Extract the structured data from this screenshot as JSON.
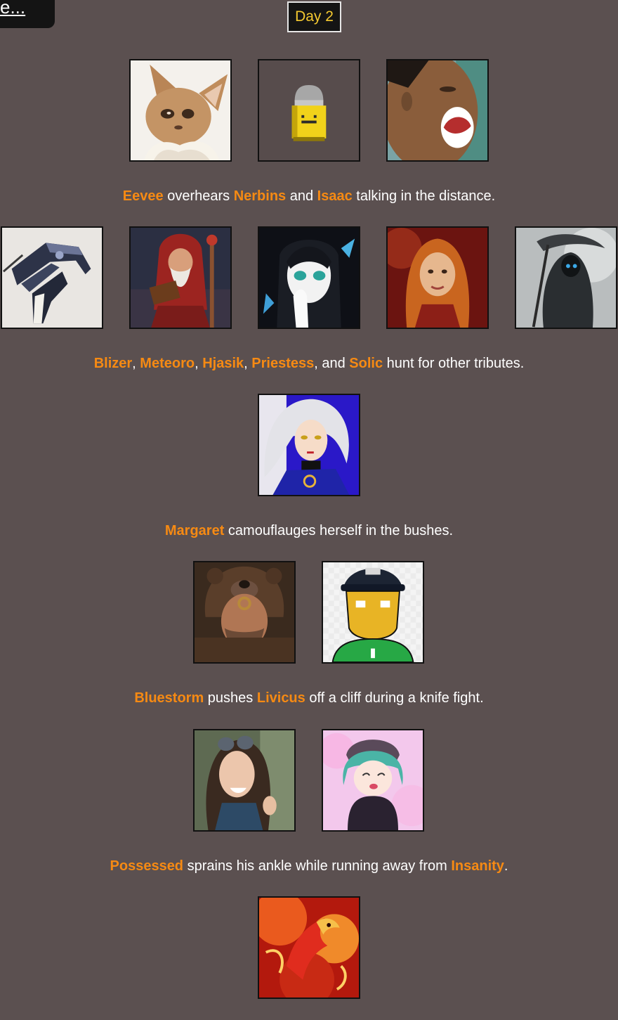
{
  "nav": {
    "back_label": "e..."
  },
  "header": {
    "day_label": "Day 2"
  },
  "colors": {
    "background": "#5b5050",
    "name_accent": "#f68a13",
    "day_text": "#f4c930"
  },
  "events": [
    {
      "portraits": [
        {
          "name": "Eevee",
          "icon": "eevee-portrait"
        },
        {
          "name": "Nerbins",
          "icon": "bullet-portrait"
        },
        {
          "name": "Isaac",
          "icon": "yelling-face-portrait"
        }
      ],
      "text": {
        "p1_name": "Eevee",
        "t1": " overhears ",
        "p2_name": "Nerbins",
        "t2": " and ",
        "p3_name": "Isaac",
        "t3": " talking in the distance."
      }
    },
    {
      "portraits": [
        {
          "name": "Blizer",
          "icon": "robot-arm-portrait"
        },
        {
          "name": "Meteoro",
          "icon": "wizard-portrait"
        },
        {
          "name": "Hjasik",
          "icon": "anime-girl-portrait"
        },
        {
          "name": "Priestess",
          "icon": "red-hair-woman-portrait"
        },
        {
          "name": "Solic",
          "icon": "reaper-portrait"
        }
      ],
      "text": {
        "p1_name": "Blizer",
        "sep1": ", ",
        "p2_name": "Meteoro",
        "sep2": ", ",
        "p3_name": "Hjasik",
        "sep3": ", ",
        "p4_name": "Priestess",
        "sep4": ", and ",
        "p5_name": "Solic",
        "tail": " hunt for other tributes."
      }
    },
    {
      "portraits": [
        {
          "name": "Margaret",
          "icon": "silver-hair-anime-portrait"
        }
      ],
      "text": {
        "p1_name": "Margaret",
        "t1": " camouflauges herself in the bushes."
      }
    },
    {
      "portraits": [
        {
          "name": "Bluestorm",
          "icon": "bear-warrior-portrait"
        },
        {
          "name": "Livicus",
          "icon": "cartoon-police-portrait"
        }
      ],
      "text": {
        "p1_name": "Bluestorm",
        "t1": " pushes ",
        "p2_name": "Livicus",
        "t2": " off a cliff during a knife fight."
      }
    },
    {
      "portraits": [
        {
          "name": "Possessed",
          "icon": "goggles-woman-portrait"
        },
        {
          "name": "Insanity",
          "icon": "chibi-girl-portrait"
        }
      ],
      "text": {
        "p1_name": "Possessed",
        "t1": " sprains his ankle while running away from ",
        "p2_name": "Insanity",
        "t2": "."
      }
    },
    {
      "portraits": [
        {
          "name": "",
          "icon": "fire-creature-portrait"
        }
      ]
    }
  ]
}
